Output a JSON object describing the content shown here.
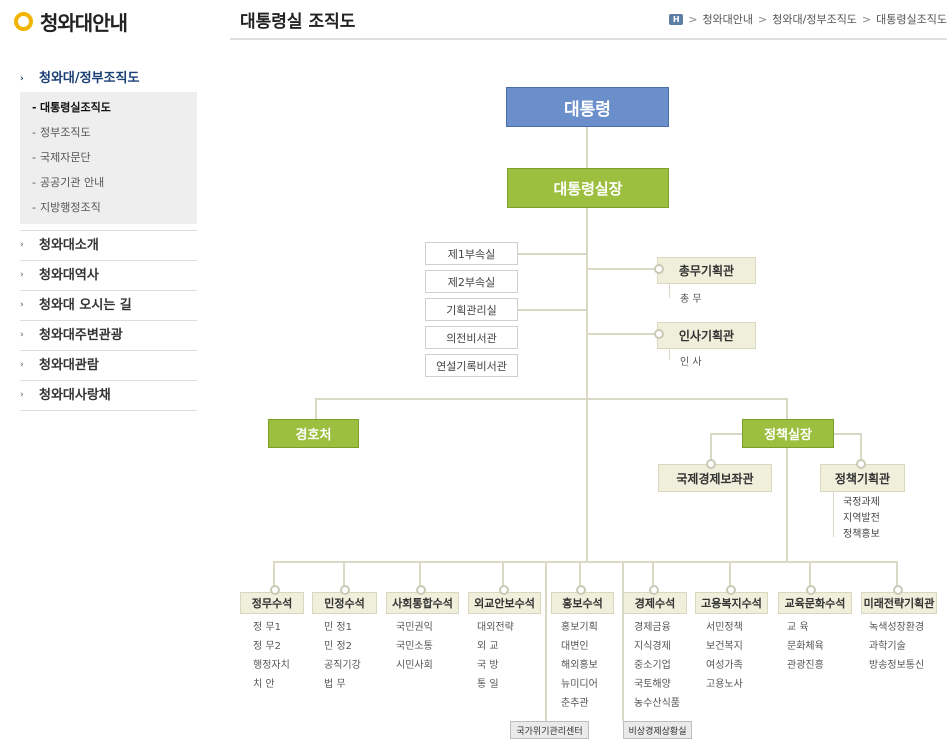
{
  "site_title": "청와대안내",
  "page_title": "대통령실 조직도",
  "breadcrumb": {
    "home_icon": "H",
    "items": [
      "청와대안내",
      "청와대/정부조직도",
      "대통령실조직도"
    ],
    "separator": ">"
  },
  "sidebar": {
    "section": "청와대/정부조직도",
    "subitems": [
      "대통령실조직도",
      "정부조직도",
      "국제자문단",
      "공공기관 안내",
      "지방행정조직"
    ],
    "items": [
      "청와대소개",
      "청와대역사",
      "청와대 오시는 길",
      "청와대주변관광",
      "청와대관람",
      "청와대사랑채"
    ]
  },
  "org": {
    "president": "대통령",
    "chief_of_staff": "대통령실장",
    "staff_offices": [
      "제1부속실",
      "제2부속실",
      "기획관리실",
      "의전비서관",
      "연설기록비서관"
    ],
    "general_affairs": {
      "title": "총무기획관",
      "sub": "총 무"
    },
    "personnel": {
      "title": "인사기획관",
      "sub": "인 사"
    },
    "security": "경호처",
    "policy_chief": "정책실장",
    "intl_econ": "국제경제보좌관",
    "policy_planning": {
      "title": "정책기획관",
      "subs": [
        "국정과제",
        "지역발전",
        "정책홍보"
      ]
    },
    "secretaries": [
      {
        "title": "정무수석",
        "subs": [
          "정 무1",
          "정 무2",
          "행정자치",
          "치 안"
        ]
      },
      {
        "title": "민정수석",
        "subs": [
          "민 정1",
          "민 정2",
          "공직기강",
          "법 무"
        ]
      },
      {
        "title": "사회통합수석",
        "subs": [
          "국민권익",
          "국민소통",
          "시민사회"
        ]
      },
      {
        "title": "외교안보수석",
        "subs": [
          "대외전략",
          "외 교",
          "국 방",
          "통 일"
        ]
      },
      {
        "title": "홍보수석",
        "subs": [
          "홍보기획",
          "대변인",
          "해외홍보",
          "뉴미디어",
          "춘추관"
        ]
      },
      {
        "title": "경제수석",
        "subs": [
          "경제금융",
          "지식경제",
          "중소기업",
          "국토해양",
          "농수산식품"
        ]
      },
      {
        "title": "고용복지수석",
        "subs": [
          "서민정책",
          "보건복지",
          "여성가족",
          "고용노사"
        ]
      },
      {
        "title": "교육문화수석",
        "subs": [
          "교 육",
          "문화체육",
          "관광진흥"
        ]
      },
      {
        "title": "미래전략기획관",
        "subs": [
          "녹색성장환경",
          "과학기술",
          "방송정보통신"
        ]
      }
    ],
    "crisis_center": "국가위기관리센터",
    "emergency_room": "비상경제상황실"
  }
}
